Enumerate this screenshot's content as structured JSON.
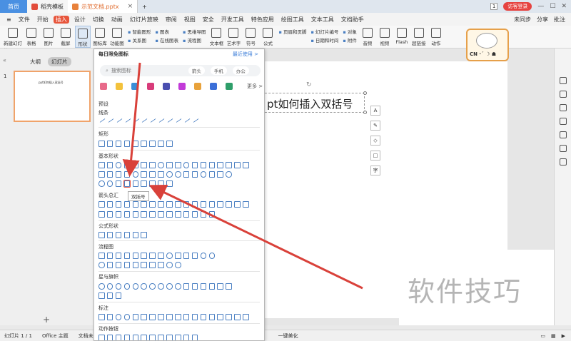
{
  "titlebar": {
    "tabs": [
      {
        "label": "首页"
      },
      {
        "label": "稻壳模板"
      },
      {
        "label": "示范文档.pptx"
      }
    ],
    "new_tab": "+",
    "page_badge": "1",
    "visitor_label": "访客登录"
  },
  "menubar": {
    "file": "文件",
    "items": [
      "开始",
      "插入",
      "设计",
      "切换",
      "动画",
      "幻灯片放映",
      "审阅",
      "视图",
      "安全",
      "开发工具",
      "特色应用",
      "绘图工具",
      "文本工具",
      "文档助手"
    ],
    "active_index": 1,
    "right": [
      "未同步",
      "分享",
      "批注"
    ]
  },
  "ribbon": {
    "buttons": [
      "新建幻灯片",
      "表格",
      "图片",
      "截屏",
      "形状",
      "图标库",
      "功能图"
    ],
    "small_group1": [
      "智能图形",
      "关系图"
    ],
    "small_group2": [
      "图表",
      "在线图表"
    ],
    "small_group3": [
      "思维导图",
      "流程图"
    ],
    "buttons2": [
      "文本框",
      "艺术字",
      "符号",
      "公式"
    ],
    "small_group4": [
      "页眉和页脚"
    ],
    "small_group5": [
      "幻灯片编号",
      "日期和时间"
    ],
    "small_group6": [
      "对象",
      "附件"
    ],
    "buttons3": [
      "音频",
      "视频",
      "Flash",
      "超链接",
      "动作"
    ]
  },
  "sidebar": {
    "tab_outline": "大纲",
    "tab_slides": "幻灯片",
    "slide_number": "1",
    "thumb_text": "ppt如何插入双括号"
  },
  "slide": {
    "title_text": "pt如何插入双括号"
  },
  "mascot": {
    "label": "CN ·ˊ ☽ ☗"
  },
  "watermark": {
    "text": "软件技巧"
  },
  "dropdown": {
    "header": "每日限免图标",
    "recent": "最近使用 >",
    "search_placeholder": "搜索图标",
    "tags": [
      "箭头",
      "手机",
      "办公"
    ],
    "more": "更多 >",
    "sections": [
      "预设",
      "线条",
      "矩形",
      "基本形状",
      "箭头总汇",
      "公式形状",
      "流程图",
      "星与旗帜",
      "标注",
      "动作按钮"
    ],
    "tooltip": "双括号"
  },
  "statusbar": {
    "slide_info": "幻灯片 1 / 1",
    "theme": "Office 主题",
    "backup": "文档未",
    "beautify": "一键美化"
  },
  "colors": {
    "accent": "#e7553b",
    "arrow": "#d9413a",
    "selection_border": "#f0a36a"
  }
}
